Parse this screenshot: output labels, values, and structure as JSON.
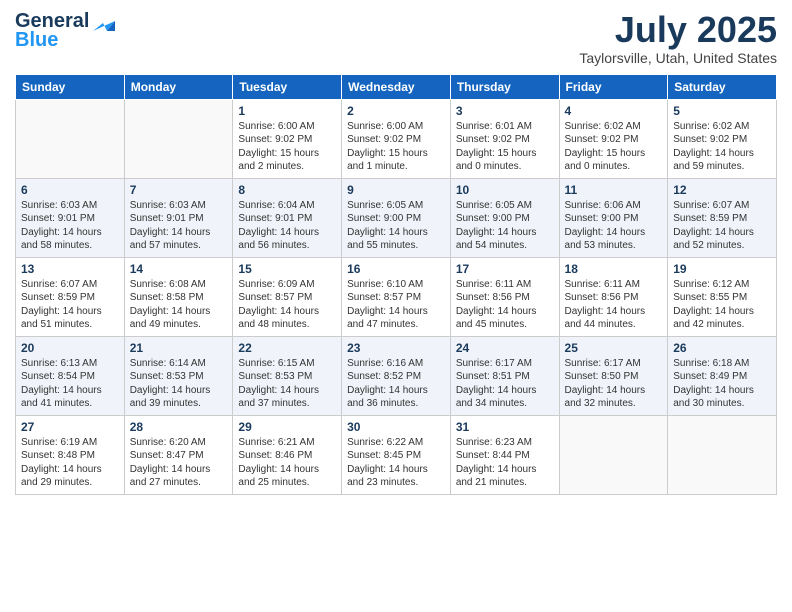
{
  "header": {
    "logo_general": "General",
    "logo_blue": "Blue",
    "title": "July 2025",
    "subtitle": "Taylorsville, Utah, United States"
  },
  "days_of_week": [
    "Sunday",
    "Monday",
    "Tuesday",
    "Wednesday",
    "Thursday",
    "Friday",
    "Saturday"
  ],
  "weeks": [
    [
      {
        "day": "",
        "info": ""
      },
      {
        "day": "",
        "info": ""
      },
      {
        "day": "1",
        "info": "Sunrise: 6:00 AM\nSunset: 9:02 PM\nDaylight: 15 hours and 2 minutes."
      },
      {
        "day": "2",
        "info": "Sunrise: 6:00 AM\nSunset: 9:02 PM\nDaylight: 15 hours and 1 minute."
      },
      {
        "day": "3",
        "info": "Sunrise: 6:01 AM\nSunset: 9:02 PM\nDaylight: 15 hours and 0 minutes."
      },
      {
        "day": "4",
        "info": "Sunrise: 6:02 AM\nSunset: 9:02 PM\nDaylight: 15 hours and 0 minutes."
      },
      {
        "day": "5",
        "info": "Sunrise: 6:02 AM\nSunset: 9:02 PM\nDaylight: 14 hours and 59 minutes."
      }
    ],
    [
      {
        "day": "6",
        "info": "Sunrise: 6:03 AM\nSunset: 9:01 PM\nDaylight: 14 hours and 58 minutes."
      },
      {
        "day": "7",
        "info": "Sunrise: 6:03 AM\nSunset: 9:01 PM\nDaylight: 14 hours and 57 minutes."
      },
      {
        "day": "8",
        "info": "Sunrise: 6:04 AM\nSunset: 9:01 PM\nDaylight: 14 hours and 56 minutes."
      },
      {
        "day": "9",
        "info": "Sunrise: 6:05 AM\nSunset: 9:00 PM\nDaylight: 14 hours and 55 minutes."
      },
      {
        "day": "10",
        "info": "Sunrise: 6:05 AM\nSunset: 9:00 PM\nDaylight: 14 hours and 54 minutes."
      },
      {
        "day": "11",
        "info": "Sunrise: 6:06 AM\nSunset: 9:00 PM\nDaylight: 14 hours and 53 minutes."
      },
      {
        "day": "12",
        "info": "Sunrise: 6:07 AM\nSunset: 8:59 PM\nDaylight: 14 hours and 52 minutes."
      }
    ],
    [
      {
        "day": "13",
        "info": "Sunrise: 6:07 AM\nSunset: 8:59 PM\nDaylight: 14 hours and 51 minutes."
      },
      {
        "day": "14",
        "info": "Sunrise: 6:08 AM\nSunset: 8:58 PM\nDaylight: 14 hours and 49 minutes."
      },
      {
        "day": "15",
        "info": "Sunrise: 6:09 AM\nSunset: 8:57 PM\nDaylight: 14 hours and 48 minutes."
      },
      {
        "day": "16",
        "info": "Sunrise: 6:10 AM\nSunset: 8:57 PM\nDaylight: 14 hours and 47 minutes."
      },
      {
        "day": "17",
        "info": "Sunrise: 6:11 AM\nSunset: 8:56 PM\nDaylight: 14 hours and 45 minutes."
      },
      {
        "day": "18",
        "info": "Sunrise: 6:11 AM\nSunset: 8:56 PM\nDaylight: 14 hours and 44 minutes."
      },
      {
        "day": "19",
        "info": "Sunrise: 6:12 AM\nSunset: 8:55 PM\nDaylight: 14 hours and 42 minutes."
      }
    ],
    [
      {
        "day": "20",
        "info": "Sunrise: 6:13 AM\nSunset: 8:54 PM\nDaylight: 14 hours and 41 minutes."
      },
      {
        "day": "21",
        "info": "Sunrise: 6:14 AM\nSunset: 8:53 PM\nDaylight: 14 hours and 39 minutes."
      },
      {
        "day": "22",
        "info": "Sunrise: 6:15 AM\nSunset: 8:53 PM\nDaylight: 14 hours and 37 minutes."
      },
      {
        "day": "23",
        "info": "Sunrise: 6:16 AM\nSunset: 8:52 PM\nDaylight: 14 hours and 36 minutes."
      },
      {
        "day": "24",
        "info": "Sunrise: 6:17 AM\nSunset: 8:51 PM\nDaylight: 14 hours and 34 minutes."
      },
      {
        "day": "25",
        "info": "Sunrise: 6:17 AM\nSunset: 8:50 PM\nDaylight: 14 hours and 32 minutes."
      },
      {
        "day": "26",
        "info": "Sunrise: 6:18 AM\nSunset: 8:49 PM\nDaylight: 14 hours and 30 minutes."
      }
    ],
    [
      {
        "day": "27",
        "info": "Sunrise: 6:19 AM\nSunset: 8:48 PM\nDaylight: 14 hours and 29 minutes."
      },
      {
        "day": "28",
        "info": "Sunrise: 6:20 AM\nSunset: 8:47 PM\nDaylight: 14 hours and 27 minutes."
      },
      {
        "day": "29",
        "info": "Sunrise: 6:21 AM\nSunset: 8:46 PM\nDaylight: 14 hours and 25 minutes."
      },
      {
        "day": "30",
        "info": "Sunrise: 6:22 AM\nSunset: 8:45 PM\nDaylight: 14 hours and 23 minutes."
      },
      {
        "day": "31",
        "info": "Sunrise: 6:23 AM\nSunset: 8:44 PM\nDaylight: 14 hours and 21 minutes."
      },
      {
        "day": "",
        "info": ""
      },
      {
        "day": "",
        "info": ""
      }
    ]
  ]
}
